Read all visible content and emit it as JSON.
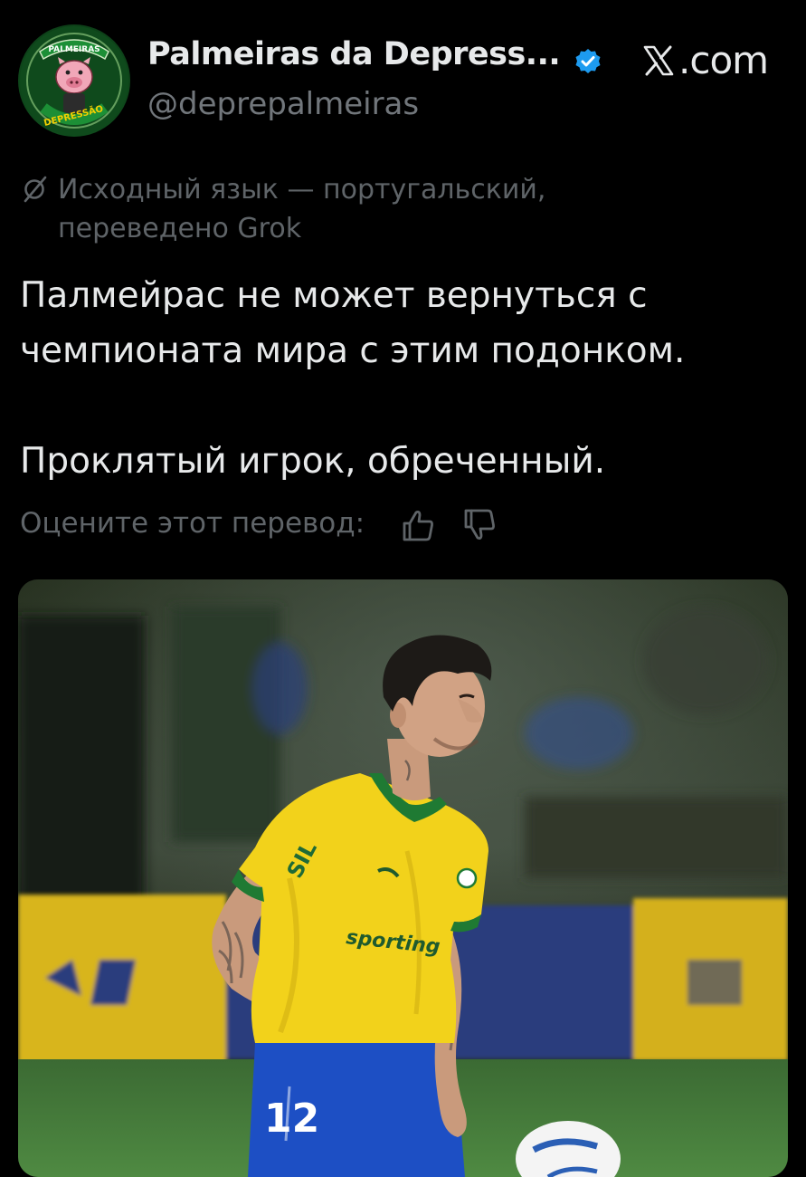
{
  "header": {
    "avatar_icon": "palmeiras-depressao-badge-icon",
    "avatar_text_top": "PALMEIRAS",
    "avatar_text_bottom": "DEPRESSÃO",
    "display_name": "Palmeiras da Depress...",
    "verified_icon": "verified-badge-icon",
    "handle": "@deprepalmeiras",
    "site_label": ".com",
    "site_icon": "x-logo-icon"
  },
  "translation": {
    "icon": "translate-icon",
    "line1": "Исходный язык — португальский,",
    "line2": "переведено Grok"
  },
  "tweet": {
    "line1": "Палмейрас не может вернуться с",
    "line2": "чемпионата мира с этим подонком.",
    "line3": "Проклятый игрок, обреченный."
  },
  "rate": {
    "label": "Оцените этот перевод:",
    "thumb_up_icon": "thumbs-up-icon",
    "thumb_down_icon": "thumbs-down-icon"
  },
  "media": {
    "description_icon": "football-player-photo",
    "shirt_text": "sporting",
    "shirt_number": "12"
  },
  "colors": {
    "background": "#000000",
    "text_primary": "#e7e9ea",
    "text_secondary": "#71767b",
    "verified_blue": "#1d9bf0",
    "jersey_yellow": "#f2d21b",
    "jersey_green": "#1f7a33",
    "shorts_blue": "#1d4fc4"
  }
}
